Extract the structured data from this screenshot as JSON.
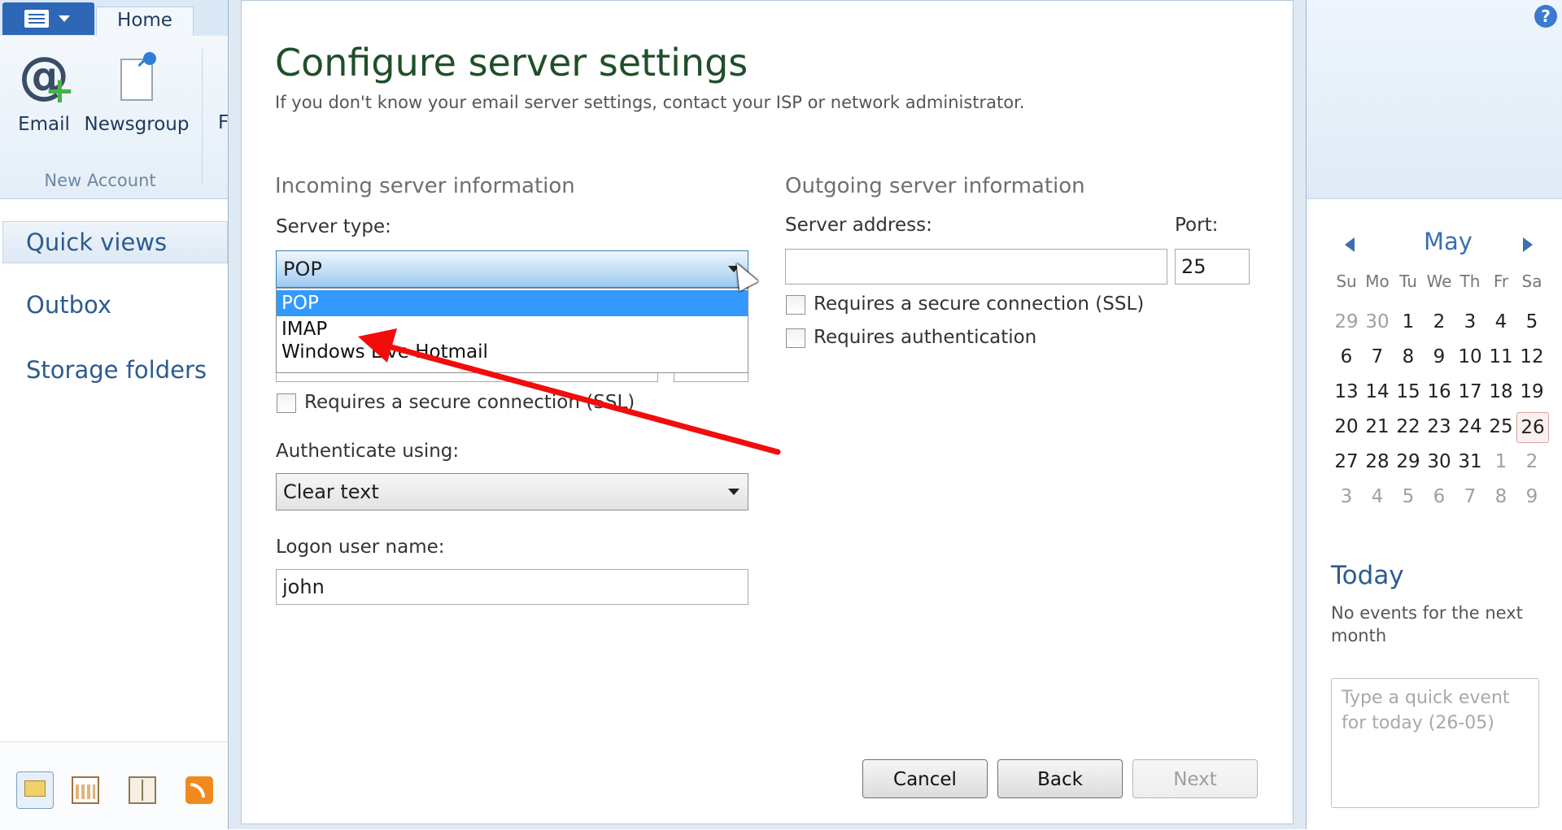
{
  "ribbon": {
    "home_tab": "Home",
    "email_label": "Email",
    "newsgroup_label": "Newsgroup",
    "cutoff_label": "F",
    "group_label": "New Account"
  },
  "nav": {
    "quick_views": "Quick views",
    "outbox": "Outbox",
    "storage_folders": "Storage folders"
  },
  "dialog": {
    "title": "Configure server settings",
    "subtitle": "If you don't know your email server settings, contact your ISP or network administrator.",
    "incoming": {
      "heading": "Incoming server information",
      "server_type_label": "Server type:",
      "server_type_value": "POP",
      "server_type_options": [
        "POP",
        "IMAP",
        "Windows Live Hotmail"
      ],
      "ssl_label": "Requires a secure connection (SSL)",
      "auth_label": "Authenticate using:",
      "auth_value": "Clear text",
      "logon_label": "Logon user name:",
      "logon_value": "john"
    },
    "outgoing": {
      "heading": "Outgoing server information",
      "server_address_label": "Server address:",
      "server_address_value": "",
      "port_label": "Port:",
      "port_value": "25",
      "ssl_label": "Requires a secure connection (SSL)",
      "auth_label": "Requires authentication"
    },
    "buttons": {
      "cancel": "Cancel",
      "back": "Back",
      "next": "Next"
    }
  },
  "calendar": {
    "month": "May",
    "weekdays": [
      "Su",
      "Mo",
      "Tu",
      "We",
      "Th",
      "Fr",
      "Sa"
    ],
    "weeks": [
      [
        "29",
        "30",
        "1",
        "2",
        "3",
        "4",
        "5"
      ],
      [
        "6",
        "7",
        "8",
        "9",
        "10",
        "11",
        "12"
      ],
      [
        "13",
        "14",
        "15",
        "16",
        "17",
        "18",
        "19"
      ],
      [
        "20",
        "21",
        "22",
        "23",
        "24",
        "25",
        "26"
      ],
      [
        "27",
        "28",
        "29",
        "30",
        "31",
        "1",
        "2"
      ],
      [
        "3",
        "4",
        "5",
        "6",
        "7",
        "8",
        "9"
      ]
    ],
    "today": "26"
  },
  "today_panel": {
    "heading": "Today",
    "message": "No events for the next month",
    "quick_event_placeholder": "Type a quick event for today (26-05)"
  },
  "colors": {
    "accent": "#3399ff",
    "title_green": "#1f4f2a",
    "annotation_arrow": "#ff0000"
  }
}
